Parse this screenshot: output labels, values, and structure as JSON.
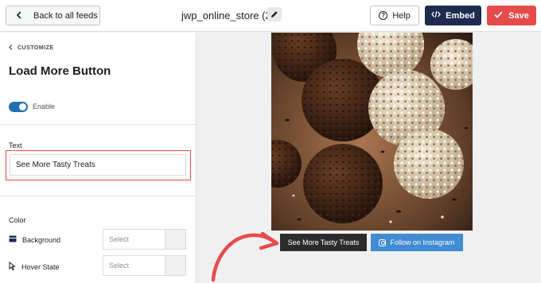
{
  "header": {
    "back_label": "Back to all feeds",
    "feed_name": "jwp_online_store (2)",
    "help_label": "Help",
    "embed_label": "Embed",
    "save_label": "Save",
    "embed_color": "#1d2b4f",
    "save_color": "#e64b4b"
  },
  "sidebar": {
    "breadcrumb": "CUSTOMIZE",
    "title": "Load More Button",
    "enable_label": "Enable",
    "enable_on": true,
    "text_section_label": "Text",
    "text_value": "See More Tasty Treats",
    "color_section_label": "Color",
    "color_rows": [
      {
        "label": "Background",
        "value": "Select"
      },
      {
        "label": "Hover State",
        "value": "Select"
      }
    ]
  },
  "preview": {
    "load_more_label": "See More Tasty Treats",
    "follow_label": "Follow on Instagram",
    "follow_color": "#408bd1"
  }
}
